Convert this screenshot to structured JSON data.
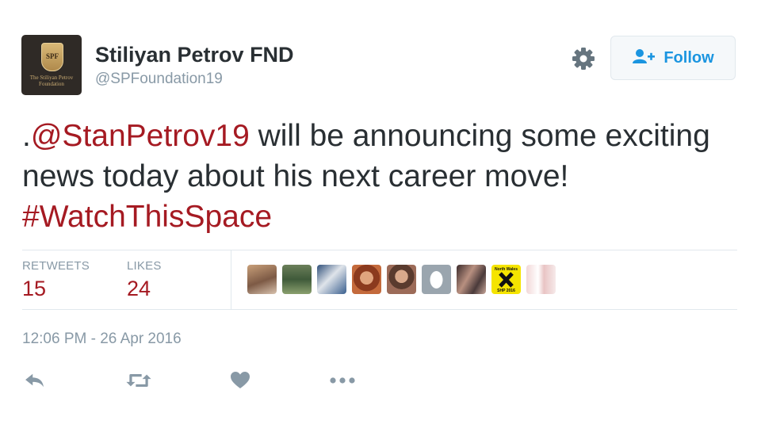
{
  "user": {
    "display_name": "Stiliyan Petrov FND",
    "handle": "@SPFoundation19",
    "avatar": {
      "crest_initials": "SPF",
      "logo_text": "The Stiliyan Petrov Foundation"
    }
  },
  "follow_button": {
    "label": "Follow",
    "icon": "add-user-icon"
  },
  "settings_icon": "gear-icon",
  "tweet": {
    "prefix": ".",
    "mention": "@StanPetrov19",
    "body": " will be announcing some exciting news today about his next career move! ",
    "hashtag": "#WatchThisSpace"
  },
  "stats": {
    "retweets_label": "RETWEETS",
    "retweets_value": "15",
    "likes_label": "LIKES",
    "likes_value": "24"
  },
  "likers": [
    {
      "name": "liker-avatar-1"
    },
    {
      "name": "liker-avatar-2"
    },
    {
      "name": "liker-avatar-3"
    },
    {
      "name": "liker-avatar-4"
    },
    {
      "name": "liker-avatar-5"
    },
    {
      "name": "liker-avatar-6"
    },
    {
      "name": "liker-avatar-7"
    },
    {
      "name": "liker-avatar-8",
      "text": "North Wales SHP 2016"
    },
    {
      "name": "liker-avatar-9"
    }
  ],
  "timestamp": "12:06 PM - 26 Apr 2016",
  "actions": [
    "reply-icon",
    "retweet-icon",
    "like-icon",
    "more-icon"
  ],
  "colors": {
    "link": "#a51a22",
    "muted": "#8899a6",
    "text": "#292f33",
    "follow_blue": "#1b95e0"
  }
}
